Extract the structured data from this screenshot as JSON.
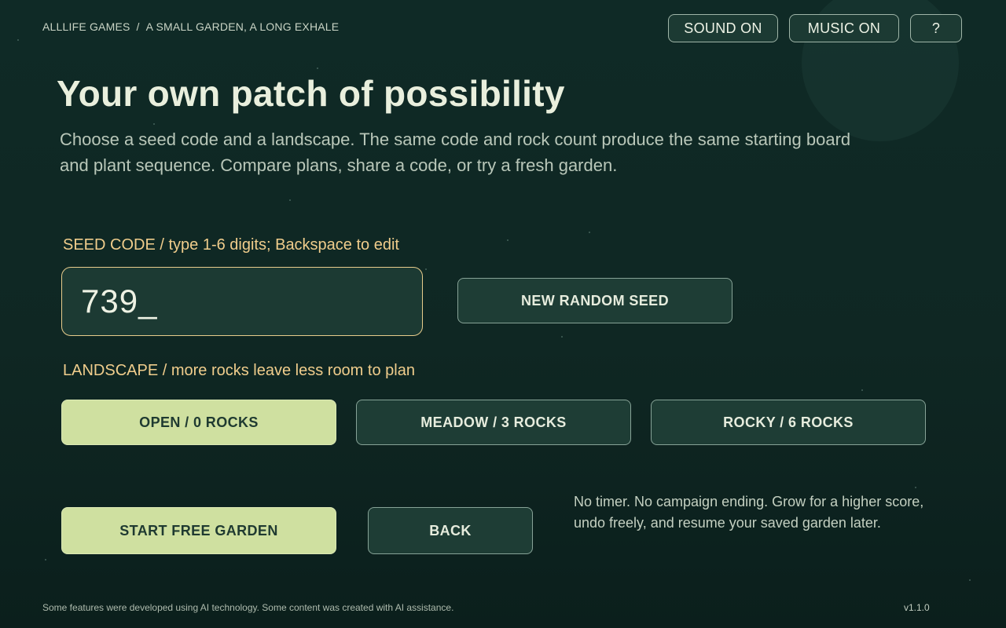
{
  "header": {
    "breadcrumb": {
      "publisher": "ALLLIFE GAMES",
      "separator": "/",
      "game": "A SMALL GARDEN, A LONG EXHALE"
    },
    "buttons": {
      "sound": "SOUND ON",
      "music": "MUSIC ON",
      "help": "?"
    }
  },
  "main": {
    "title": "Your own patch of possibility",
    "intro": "Choose a seed code and a landscape. The same code and rock count produce the same starting board and plant sequence. Compare plans, share a code, or try a fresh garden.",
    "seed": {
      "label": "SEED CODE / type 1-6 digits; Backspace to edit",
      "value": "739_",
      "random_button": "NEW RANDOM SEED"
    },
    "landscape": {
      "label": "LANDSCAPE / more rocks leave less room to plan",
      "options": [
        {
          "label": "OPEN / 0 ROCKS",
          "selected": true
        },
        {
          "label": "MEADOW / 3 ROCKS",
          "selected": false
        },
        {
          "label": "ROCKY / 6 ROCKS",
          "selected": false
        }
      ]
    },
    "actions": {
      "start": "START FREE GARDEN",
      "back": "BACK"
    },
    "note": "No timer. No campaign ending. Grow for a higher score, undo freely, and resume your saved garden later."
  },
  "footer": {
    "disclaimer": "Some features were developed using AI technology. Some content was created with AI assistance.",
    "version": "v1.1.0"
  },
  "colors": {
    "background": "#0f2a26",
    "accent_label": "#f0cd8c",
    "selected_button": "#cfe0a0",
    "button": "#1e3d35"
  }
}
